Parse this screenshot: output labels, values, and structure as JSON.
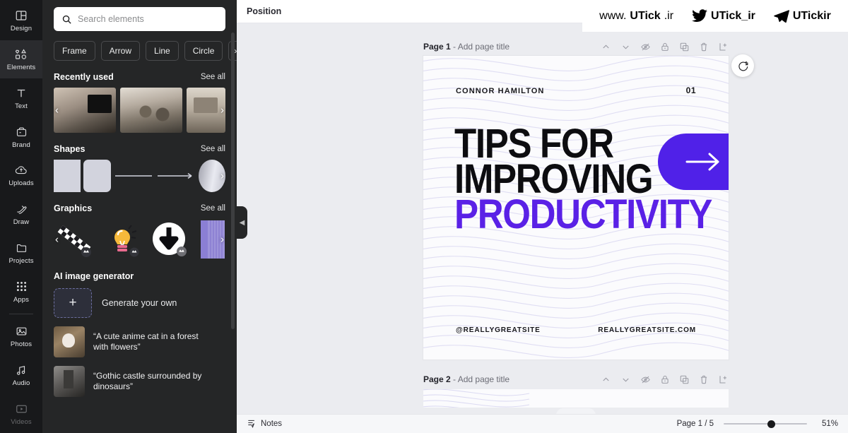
{
  "rail": {
    "items": [
      {
        "label": "Design",
        "icon": "design-icon",
        "active": false
      },
      {
        "label": "Elements",
        "icon": "elements-icon",
        "active": true
      },
      {
        "label": "Text",
        "icon": "text-icon",
        "active": false
      },
      {
        "label": "Brand",
        "icon": "brand-icon",
        "active": false
      },
      {
        "label": "Uploads",
        "icon": "uploads-icon",
        "active": false
      },
      {
        "label": "Draw",
        "icon": "draw-icon",
        "active": false
      },
      {
        "label": "Projects",
        "icon": "projects-icon",
        "active": false
      },
      {
        "label": "Apps",
        "icon": "apps-icon",
        "active": false
      },
      {
        "label": "Photos",
        "icon": "photos-icon",
        "active": false
      },
      {
        "label": "Audio",
        "icon": "audio-icon",
        "active": false
      },
      {
        "label": "Videos",
        "icon": "videos-icon",
        "active": false
      }
    ]
  },
  "panel": {
    "search": {
      "placeholder": "Search elements",
      "value": "",
      "icon": "search-icon"
    },
    "chips": [
      "Frame",
      "Arrow",
      "Line",
      "Circle"
    ],
    "chip_more": "›",
    "sections": [
      {
        "title": "Recently used",
        "see_all": "See all"
      },
      {
        "title": "Shapes",
        "see_all": "See all"
      },
      {
        "title": "Graphics",
        "see_all": "See all"
      }
    ],
    "ai": {
      "title": "AI image generator",
      "generate_label": "Generate your own",
      "prompts": [
        "“A cute anime cat in a forest with flowers”",
        "“Gothic castle surrounded by dinosaurs”"
      ]
    }
  },
  "topbar": {
    "position_label": "Position"
  },
  "pages": [
    {
      "label": "Page 1",
      "separator": " - ",
      "title_placeholder": "Add page title",
      "tools": [
        "move-up",
        "move-down",
        "hide-page",
        "lock-page",
        "duplicate-page",
        "delete-page",
        "add-page"
      ]
    },
    {
      "label": "Page 2",
      "separator": " - ",
      "title_placeholder": "Add page title",
      "tools": [
        "move-up",
        "move-down",
        "hide-page",
        "lock-page",
        "duplicate-page",
        "delete-page",
        "add-page"
      ]
    }
  ],
  "design": {
    "author": "CONNOR HAMILTON",
    "number": "01",
    "title_line1": "TIPS FOR",
    "title_line2": "IMPROVING",
    "title_line3": "PRODUCTIVITY",
    "handle": "@REALLYGREATSITE",
    "website": "REALLYGREATSITE.COM",
    "accent_color": "#5021e8",
    "arrow_glyph": "→"
  },
  "magic_button": {
    "icon": "magic-refresh-icon"
  },
  "status": {
    "notes_label": "Notes",
    "notes_icon": "notes-icon",
    "page_indicator": "Page 1 / 5",
    "zoom_level": "51%"
  },
  "watermark": {
    "site": {
      "prefix": "www.",
      "brand": "UTick",
      "suffix": ".ir"
    },
    "twitter": {
      "icon": "twitter-bird-icon",
      "handle": "UTick_ir"
    },
    "telegram": {
      "icon": "telegram-plane-icon",
      "handle": "UTickir"
    }
  }
}
